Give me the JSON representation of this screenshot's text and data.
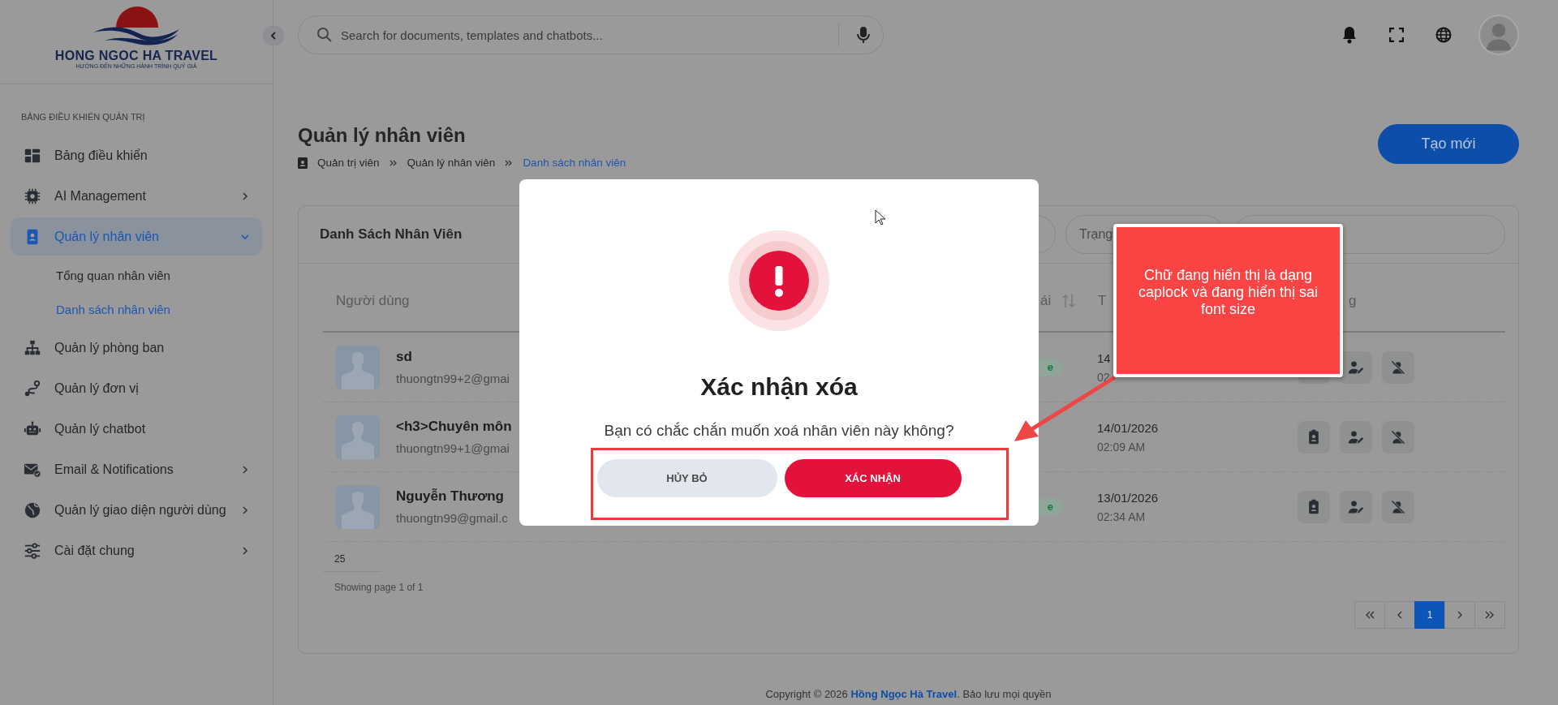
{
  "sidebar": {
    "brand": {
      "name": "HONG NGOC HA TRAVEL",
      "tagline": "HƯỚNG ĐẾN NHỮNG HÀNH TRÌNH QUÝ GIÁ"
    },
    "section_label": "BẢNG ĐIỀU KHIỂN QUẢN TRỊ",
    "items": [
      {
        "label": "Bảng điều khiển",
        "selected": false
      },
      {
        "label": "AI Management",
        "selected": false,
        "expanded": false
      },
      {
        "label": "Quản lý nhân viên",
        "selected": true,
        "expanded": true,
        "children": [
          {
            "label": "Tổng quan nhân viên",
            "selected": false
          },
          {
            "label": "Danh sách nhân viên",
            "selected": true
          }
        ]
      },
      {
        "label": "Quản lý phòng ban",
        "selected": false
      },
      {
        "label": "Quản lý đơn vị",
        "selected": false
      },
      {
        "label": "Quản lý chatbot",
        "selected": false
      },
      {
        "label": "Email & Notifications",
        "selected": false,
        "expanded": false
      },
      {
        "label": "Quản lý giao diện người dùng",
        "selected": false,
        "expanded": false
      },
      {
        "label": "Cài đặt chung",
        "selected": false,
        "expanded": false
      }
    ]
  },
  "search": {
    "placeholder": "Search for documents, templates and chatbots..."
  },
  "page": {
    "title": "Quản lý nhân viên",
    "breadcrumb": [
      {
        "label": "Quản trị viên",
        "current": false
      },
      {
        "label": "Quản lý nhân viên",
        "current": false
      },
      {
        "label": "Danh sách nhân viên",
        "current": true
      }
    ],
    "create_button": "Tạo mới"
  },
  "card": {
    "title": "Danh Sách Nhân Viên",
    "status_filter": {
      "placeholder": "Trạng"
    },
    "columns": [
      {
        "label": "Người dùng"
      },
      {
        "label": "ái",
        "sortable": true
      },
      {
        "label": "T"
      },
      {
        "label": "g"
      }
    ],
    "rows": [
      {
        "name": "sd",
        "email": "thuongtn99+2@gmai",
        "status": "e",
        "date": "14",
        "time": "02"
      },
      {
        "name": "<h3>Chuyên môn",
        "email": "thuongtn99+1@gmai",
        "date": "14/01/2026",
        "time": "02:09 AM"
      },
      {
        "name": "Nguyễn Thương",
        "email": "thuongtn99@gmail.c",
        "status": "e",
        "date": "13/01/2026",
        "time": "02:34 AM"
      }
    ],
    "page_size": "25",
    "info": "Showing page 1 of 1",
    "pages": [
      {
        "label": "1",
        "selected": true
      }
    ]
  },
  "footer": "Copyright © 2026 **Hồng Ngọc Hà Travel**. Bảo lưu mọi quyền",
  "modal": {
    "title": "Xác nhận xóa",
    "message": "Bạn có chắc chắn muốn xoá nhân viên này không?",
    "buttons": [
      {
        "label": "HỦY BỎ",
        "kind": "secondary"
      },
      {
        "label": "XÁC NHẬN",
        "kind": "primary"
      }
    ]
  },
  "annotation": {
    "text": "Chữ đang hiển thị là dạng caplock và đang hiển thị sai font size"
  }
}
